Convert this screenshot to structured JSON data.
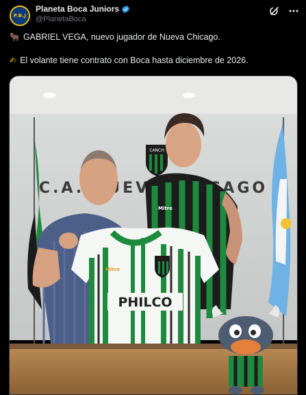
{
  "account": {
    "display_name": "Planeta Boca Juniors",
    "handle": "@PlanetaBoca",
    "avatar_text": "P.B.J",
    "verified": true
  },
  "icons": {
    "verified": "verified-badge-icon",
    "grok": "grok-icon",
    "more": "more-options-icon",
    "line1": "bull-emoji",
    "line2": "writing-hand-emoji"
  },
  "tweet": {
    "line1_emoji": "🐂",
    "line1": "GABRIEL VEGA, nuevo jugador de Nueva Chicago.",
    "line2_emoji": "✍",
    "line2": "El volante tiene contrato con Boca hasta diciembre de 2026."
  },
  "photo": {
    "wall_text": "C.A. NUEVA CHICAGO",
    "shirt_sponsor": "PHILCO",
    "shirt_brand": "Mitre",
    "badge_text": "CANCH"
  },
  "colors": {
    "background": "#000000",
    "text": "#e7e9ea",
    "muted": "#71767b",
    "verified": "#1d9bf0",
    "club_green": "#1e8a3e"
  }
}
